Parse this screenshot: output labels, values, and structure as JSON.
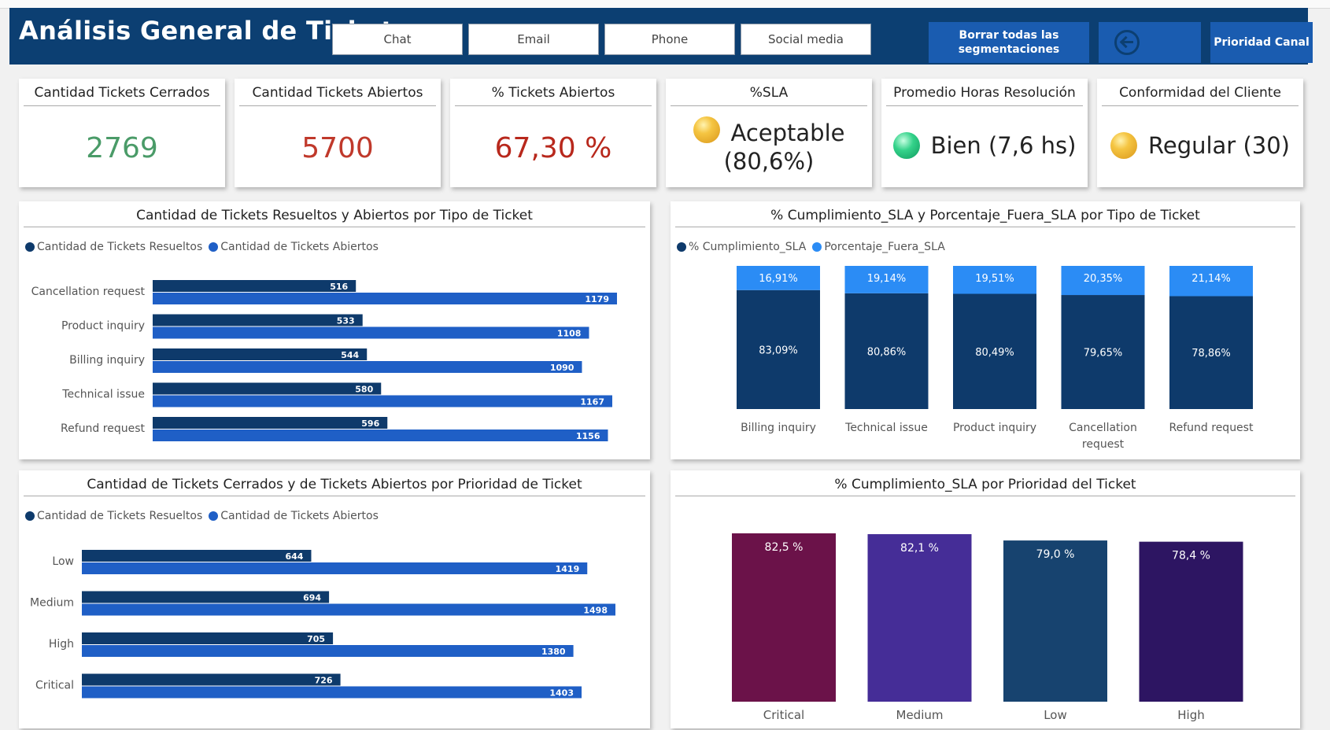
{
  "header": {
    "title": "Análisis General de Tickets",
    "slicers": [
      "Chat",
      "Email",
      "Phone",
      "Social media"
    ],
    "clear_button": "Borrar todas las segmentaciones",
    "back_icon": "arrow-left-circle-icon",
    "priority_button": "Prioridad Canal"
  },
  "kpis": {
    "closed": {
      "title": "Cantidad Tickets Cerrados",
      "value": "2769",
      "color": "#4a9b68"
    },
    "open": {
      "title": "Cantidad Tickets Abiertos",
      "value": "5700",
      "color": "#c0392b"
    },
    "open_pct": {
      "title": "% Tickets Abiertos",
      "value": "67,30 %",
      "color": "#b8281c"
    },
    "sla": {
      "title": "%SLA",
      "line1": "Aceptable",
      "line2": "(80,6%)",
      "indicator": "yellow"
    },
    "hours": {
      "title": "Promedio Horas Resolución",
      "value": "Bien (7,6 hs)",
      "indicator": "green"
    },
    "satisfaction": {
      "title": "Conformidad del Cliente",
      "value": "Regular (30)",
      "indicator": "yellow"
    }
  },
  "colors": {
    "resolved": "#0e3a6b",
    "open": "#1f5fc6",
    "sla_in": "#0e3a6b",
    "sla_out": "#2b8cf5",
    "critical": "#6b1249",
    "medium": "#452d97",
    "low": "#17436f",
    "high": "#2d1562"
  },
  "panels": {
    "by_type": {
      "title": "Cantidad de Tickets Resueltos y Abiertos por Tipo de Ticket",
      "legend": [
        "Cantidad de Tickets Resueltos",
        "Cantidad de Tickets Abiertos"
      ]
    },
    "sla_by_type": {
      "title": "% Cumplimiento_SLA y Porcentaje_Fuera_SLA por Tipo de Ticket",
      "legend": [
        "% Cumplimiento_SLA",
        "Porcentaje_Fuera_SLA"
      ]
    },
    "by_priority": {
      "title": "Cantidad de Tickets Cerrados y de Tickets Abiertos por Prioridad de Ticket",
      "legend": [
        "Cantidad de Tickets Resueltos",
        "Cantidad de Tickets Abiertos"
      ]
    },
    "sla_by_priority": {
      "title": "% Cumplimiento_SLA por Prioridad del Ticket"
    }
  },
  "chart_data": [
    {
      "type": "bar",
      "orientation": "horizontal",
      "title": "Cantidad de Tickets Resueltos y Abiertos por Tipo de Ticket",
      "categories": [
        "Cancellation request",
        "Product inquiry",
        "Billing inquiry",
        "Technical issue",
        "Refund request"
      ],
      "series": [
        {
          "name": "Cantidad de Tickets Resueltos",
          "values": [
            516,
            533,
            544,
            580,
            596
          ]
        },
        {
          "name": "Cantidad de Tickets Abiertos",
          "values": [
            1179,
            1108,
            1090,
            1167,
            1156
          ]
        }
      ],
      "legend": "top-left",
      "grid": false
    },
    {
      "type": "bar",
      "stacked": true,
      "title": "% Cumplimiento_SLA y Porcentaje_Fuera_SLA por Tipo de Ticket",
      "categories": [
        "Billing inquiry",
        "Technical issue",
        "Product inquiry",
        "Cancellation request",
        "Refund request"
      ],
      "series": [
        {
          "name": "% Cumplimiento_SLA",
          "values": [
            83.09,
            80.86,
            80.49,
            79.65,
            78.86
          ],
          "labels": [
            "83,09%",
            "80,86%",
            "80,49%",
            "79,65%",
            "78,86%"
          ]
        },
        {
          "name": "Porcentaje_Fuera_SLA",
          "values": [
            16.91,
            19.14,
            19.51,
            20.35,
            21.14
          ],
          "labels": [
            "16,91%",
            "19,14%",
            "19,51%",
            "20,35%",
            "21,14%"
          ]
        }
      ],
      "legend": "top-left",
      "grid": false
    },
    {
      "type": "bar",
      "orientation": "horizontal",
      "title": "Cantidad de Tickets Cerrados y de Tickets Abiertos por Prioridad de Ticket",
      "categories": [
        "Low",
        "Medium",
        "High",
        "Critical"
      ],
      "series": [
        {
          "name": "Cantidad de Tickets Resueltos",
          "values": [
            644,
            694,
            705,
            726
          ]
        },
        {
          "name": "Cantidad de Tickets Abiertos",
          "values": [
            1419,
            1498,
            1380,
            1403
          ]
        }
      ],
      "legend": "top-left",
      "grid": false
    },
    {
      "type": "bar",
      "title": "% Cumplimiento_SLA por Prioridad del Ticket",
      "categories": [
        "Critical",
        "Medium",
        "Low",
        "High"
      ],
      "values": [
        82.5,
        82.1,
        79.0,
        78.4
      ],
      "labels": [
        "82,5 %",
        "82,1 %",
        "79,0 %",
        "78,4 %"
      ],
      "colors": [
        "#6b1249",
        "#452d97",
        "#17436f",
        "#2d1562"
      ],
      "grid": false
    }
  ]
}
